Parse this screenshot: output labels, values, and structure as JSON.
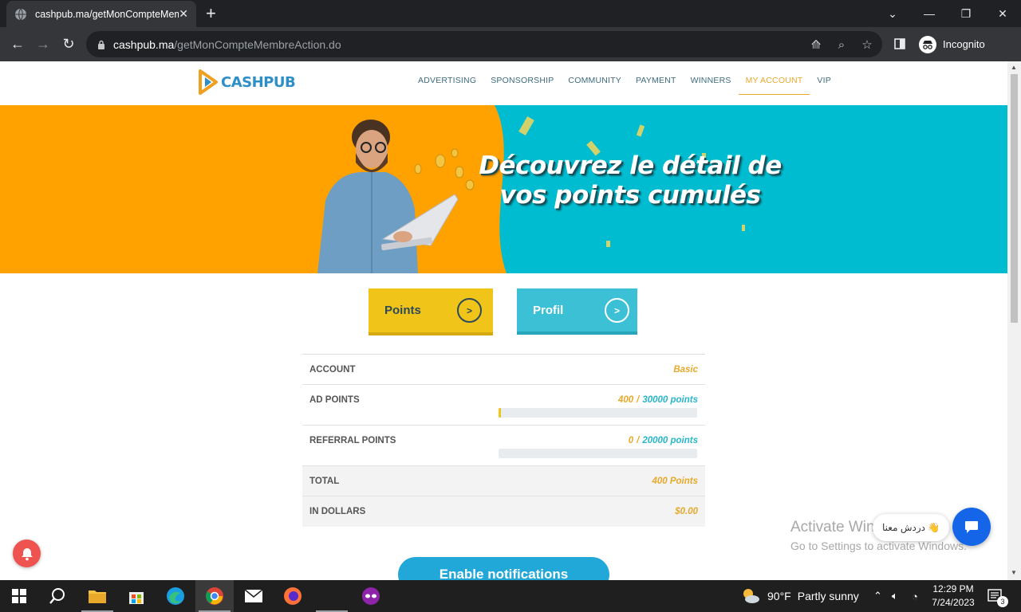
{
  "browser": {
    "tab_title": "cashpub.ma/getMonCompteMembreAction.do",
    "url_domain": "cashpub.ma",
    "url_path": "/getMonCompteMembreAction.do",
    "incognito_label": "Incognito"
  },
  "site": {
    "logo_text": "CASHPUB",
    "nav": [
      "ADVERTISING",
      "SPONSORSHIP",
      "COMMUNITY",
      "PAYMENT",
      "WINNERS",
      "MY ACCOUNT",
      "VIP"
    ],
    "active_nav": "MY ACCOUNT",
    "banner_line1": "Découvrez le détail de",
    "banner_line2": "vos points cumulés",
    "buttons": {
      "points": "Points",
      "profil": "Profil",
      "arrow": ">"
    },
    "account_table": {
      "account_label": "ACCOUNT",
      "account_value": "Basic",
      "ad_points_label": "AD POINTS",
      "ad_points_current": "400",
      "ad_points_max": "30000 points",
      "ad_points_fraction": 0.013,
      "referral_label": "REFERRAL POINTS",
      "referral_current": "0",
      "referral_max": "20000 points",
      "referral_fraction": 0,
      "total_label": "TOTAL",
      "total_value": "400 Points",
      "dollars_label": "IN DOLLARS",
      "dollars_value": "$0.00",
      "slash": "/"
    },
    "enable_notifications": "Enable notifications",
    "chat_bubble_text": "دردش معنا 👋",
    "activate_title": "Activate Windows",
    "activate_sub": "Go to Settings to activate Windows."
  },
  "taskbar": {
    "weather_temp": "90°F",
    "weather_text": "Partly sunny",
    "time": "12:29 PM",
    "date": "7/24/2023",
    "notification_count": "3"
  },
  "colors": {
    "accent_gold": "#e7a92c",
    "accent_teal": "#2ab6ca",
    "banner_orange": "#ffa200",
    "banner_teal": "#00bcd0",
    "points_button": "#f0c419",
    "profil_button": "#3bc0d6"
  }
}
